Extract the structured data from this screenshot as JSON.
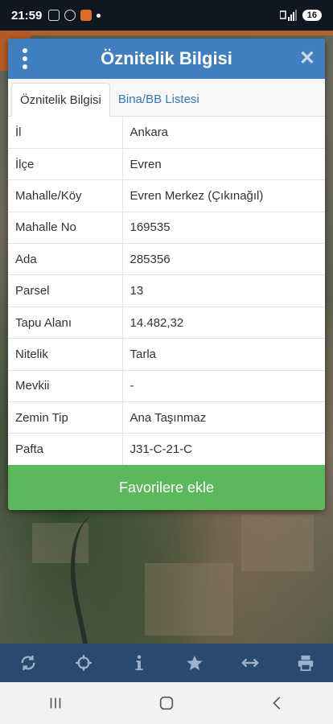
{
  "status": {
    "time": "21:59",
    "battery": "16"
  },
  "dialog": {
    "title": "Öznitelik Bilgisi",
    "tabs": [
      {
        "label": "Öznitelik Bilgisi",
        "active": true
      },
      {
        "label": "Bina/BB Listesi",
        "active": false
      }
    ],
    "rows": [
      {
        "key": "İl",
        "value": "Ankara"
      },
      {
        "key": "İlçe",
        "value": "Evren"
      },
      {
        "key": "Mahalle/Köy",
        "value": "Evren Merkez (Çıkınağıl)"
      },
      {
        "key": "Mahalle No",
        "value": "169535"
      },
      {
        "key": "Ada",
        "value": "285356"
      },
      {
        "key": "Parsel",
        "value": "13"
      },
      {
        "key": "Tapu Alanı",
        "value": "14.482,32"
      },
      {
        "key": "Nitelik",
        "value": "Tarla"
      },
      {
        "key": "Mevkii",
        "value": "-"
      },
      {
        "key": "Zemin Tip",
        "value": "Ana Taşınmaz"
      },
      {
        "key": "Pafta",
        "value": "J31-C-21-C"
      }
    ],
    "favorite_label": "Favorilere ekle"
  },
  "toolbar": {
    "icons": [
      "refresh-icon",
      "crosshair-icon",
      "info-icon",
      "star-icon",
      "measure-icon",
      "print-icon"
    ]
  },
  "colors": {
    "header": "#3f7fc0",
    "toolbar": "#274a6e",
    "favorite": "#5cb85c",
    "tab_link": "#3a78b5"
  }
}
